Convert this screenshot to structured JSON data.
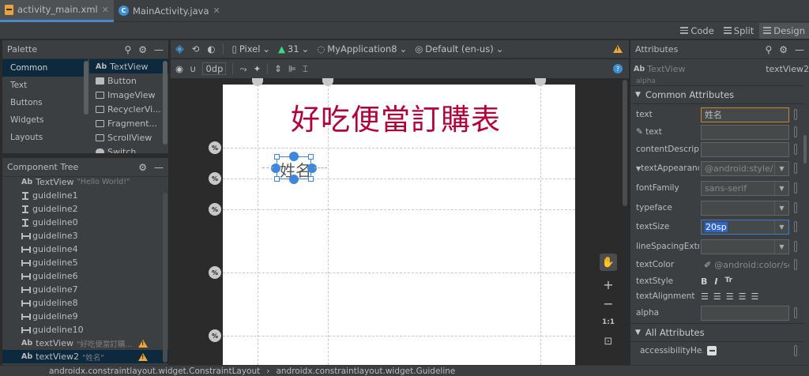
{
  "tabs": [
    {
      "label": "activity_main.xml",
      "active": true
    },
    {
      "label": "MainActivity.java",
      "active": false
    }
  ],
  "modes": {
    "code": "Code",
    "split": "Split",
    "design": "Design"
  },
  "palette": {
    "title": "Palette",
    "categories": [
      "Common",
      "Text",
      "Buttons",
      "Widgets",
      "Layouts"
    ],
    "components": [
      "TextView",
      "Button",
      "ImageView",
      "RecyclerVi...",
      "Fragment...",
      "ScrollView",
      "Switch"
    ]
  },
  "tree": {
    "title": "Component Tree",
    "items": [
      {
        "label": "TextView",
        "hint": "\"Hello World!\""
      },
      {
        "label": "guideline1"
      },
      {
        "label": "guideline2"
      },
      {
        "label": "guideline0"
      },
      {
        "label": "guideline3"
      },
      {
        "label": "guideline4"
      },
      {
        "label": "guideline5"
      },
      {
        "label": "guideline6"
      },
      {
        "label": "guideline7"
      },
      {
        "label": "guideline8"
      },
      {
        "label": "guideline9"
      },
      {
        "label": "guideline10"
      },
      {
        "label": "textView",
        "hint": "\"好吃便當訂購..."
      },
      {
        "label": "textView2",
        "hint": "\"姓名\""
      }
    ]
  },
  "toolbar": {
    "device": "Pixel",
    "api": "31",
    "app": "MyApplication8",
    "locale": "Default (en-us)",
    "margin": "0dp"
  },
  "canvas": {
    "title_text": "好吃便當訂購表",
    "name_text": "姓名",
    "pct": "%",
    "zoom": "1:1"
  },
  "attributes": {
    "title": "Attributes",
    "widget_type": "TextView",
    "widget_id": "textView2",
    "common_header": "Common Attributes",
    "all_header": "All Attributes",
    "rows": {
      "text_label": "text",
      "text_value": "姓名",
      "tools_text_label": "text",
      "content_label": "contentDescripti...",
      "appearance_label": "textAppearance",
      "appearance_value": "@android:style/",
      "font_label": "fontFamily",
      "font_value": "sans-serif",
      "typeface_label": "typeface",
      "size_label": "textSize",
      "size_value": "20sp",
      "spacing_label": "lineSpacingExtra",
      "color_label": "textColor",
      "color_value": "@android:color/se",
      "style_label": "textStyle",
      "align_label": "textAlignment",
      "alpha_label": "alpha",
      "access_label": "accessibilityHe...",
      "alpha_header_clip": "alpha"
    }
  },
  "status": {
    "path1": "androidx.constraintlayout.widget.ConstraintLayout",
    "arrow": "›",
    "path2": "androidx.constraintlayout.widget.Guideline"
  }
}
